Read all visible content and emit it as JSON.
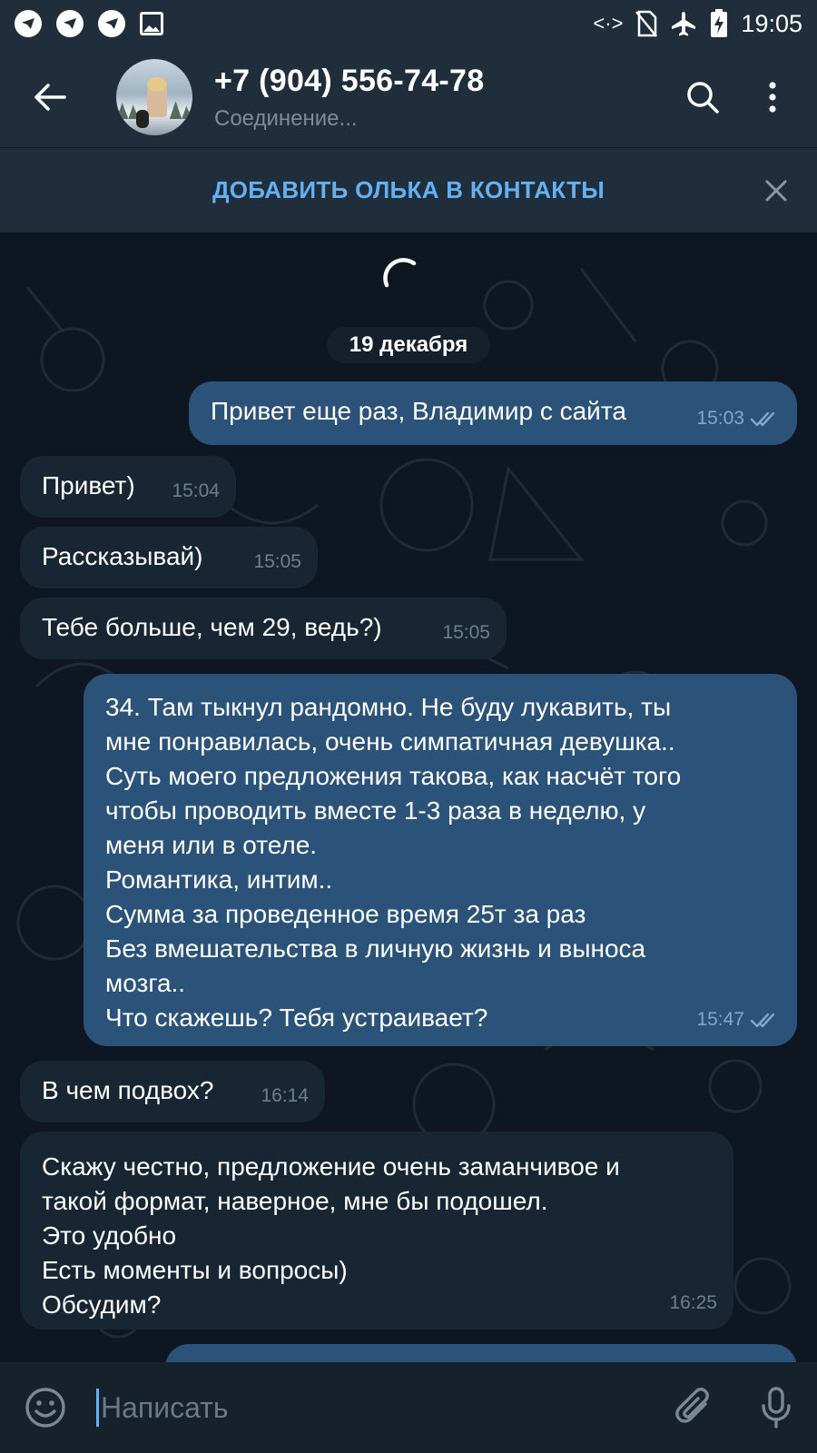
{
  "status_bar": {
    "time": "19:05",
    "app_icons": [
      "telegram-icon",
      "telegram-icon",
      "telegram-icon",
      "image-icon"
    ],
    "system_icons": [
      "data-arrows-icon",
      "no-sim-icon",
      "airplane-icon",
      "battery-charging-icon"
    ],
    "data_glyph": "<·>"
  },
  "header": {
    "title": "+7 (904) 556-74-78",
    "status": "Соединение..."
  },
  "add_contact": {
    "label": "ДОБАВИТЬ ОЛЬКА В КОНТАКТЫ"
  },
  "chat": {
    "date": "19 декабря",
    "messages": [
      {
        "dir": "out",
        "text": "Привет еще раз, Владимир с сайта",
        "time": "15:03",
        "read": true
      },
      {
        "dir": "in",
        "text": "Привет)",
        "time": "15:04"
      },
      {
        "dir": "in",
        "text": "Рассказывай)",
        "time": "15:05"
      },
      {
        "dir": "in",
        "text": "Тебе больше, чем 29, ведь?)",
        "time": "15:05"
      },
      {
        "dir": "out",
        "text": "34. Там тыкнул рандомно. Не буду лукавить, ты\nмне понравилась, очень симпатичная девушка..\nСуть моего предложения такова, как насчёт того\nчтобы проводить вместе 1-3 раза в неделю, у\nменя или в отеле.\nРомантика, интим..\nСумма за проведенное время 25т за раз\nБез вмешательства в личную жизнь и выноса\nмозга..\nЧто скажешь? Тебя устраивает?",
        "time": "15:47",
        "read": true
      },
      {
        "dir": "in",
        "text": "В чем подвох?",
        "time": "16:14"
      },
      {
        "dir": "in",
        "text": "Скажу честно, предложение очень заманчивое и\nтакой формат, наверное, мне бы подошел.\nЭто удобно\nЕсть моменты и вопросы)\nОбсудим?",
        "time": "16:25"
      }
    ]
  },
  "composer": {
    "placeholder": "Написать"
  },
  "colors": {
    "accent": "#63b1f0",
    "header_bg": "#202d3b",
    "chat_bg": "#0e1621",
    "incoming_bubble": "#182533",
    "outgoing_bubble": "#2b5278"
  }
}
